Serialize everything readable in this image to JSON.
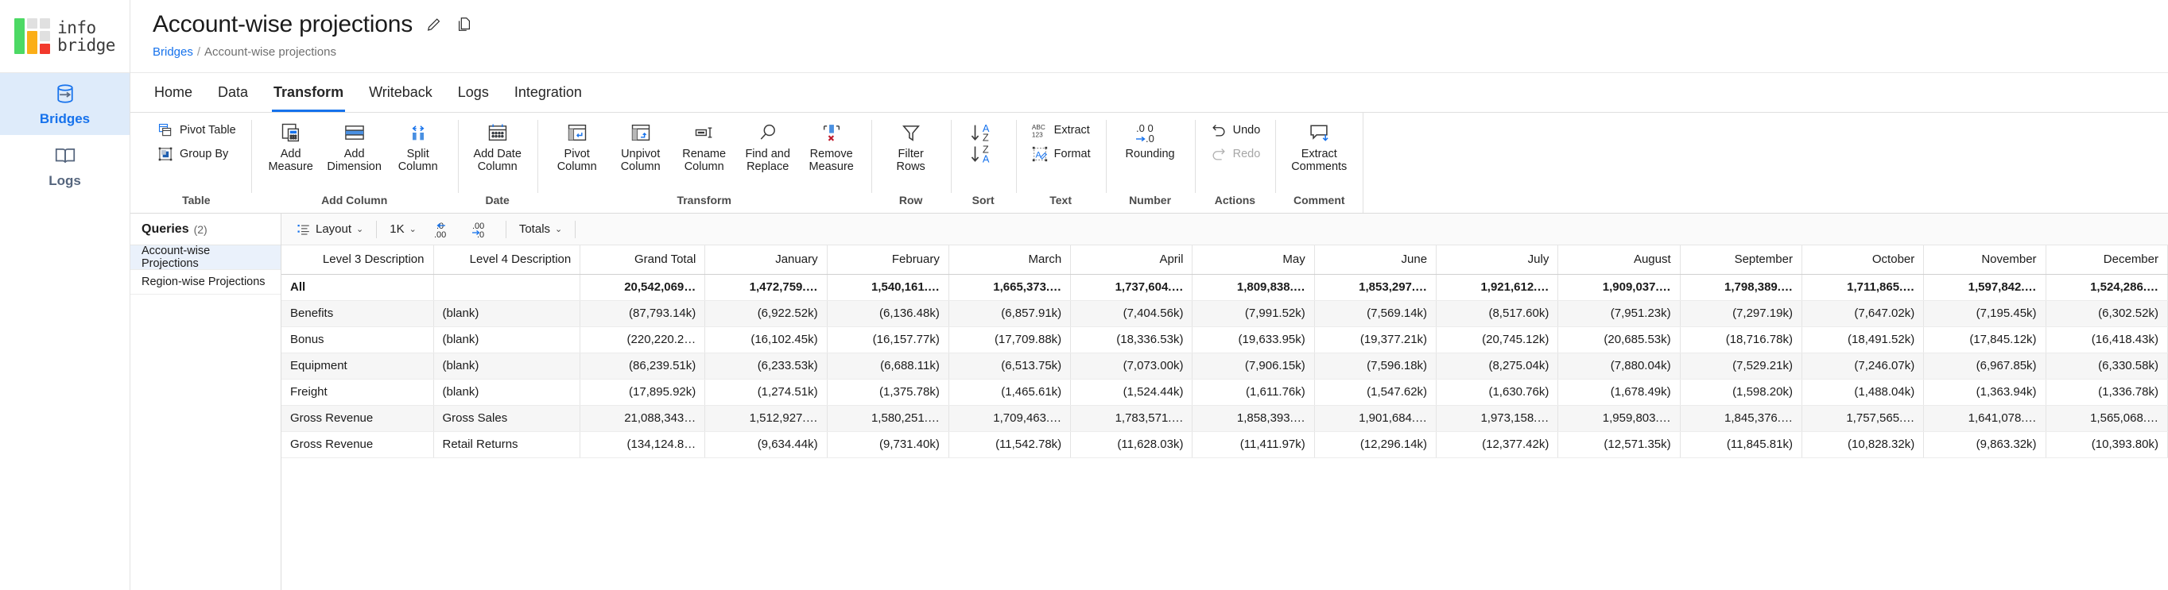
{
  "brand": {
    "word1": "info",
    "word2": "bridge",
    "colors": {
      "red": "#f2392c",
      "orange": "#fbae17",
      "green": "#4cd964",
      "grey": "#e0e0e0",
      "accent": "#1672ec"
    }
  },
  "rail": {
    "items": [
      {
        "label": "Bridges",
        "icon": "database-bridge-icon",
        "active": true
      },
      {
        "label": "Logs",
        "icon": "book-icon",
        "active": false
      }
    ]
  },
  "header": {
    "title": "Account-wise projections",
    "edit_icon": "pencil-icon",
    "copy_icon": "copy-icon",
    "breadcrumb": {
      "root": "Bridges",
      "separator": "/",
      "current": "Account-wise projections"
    }
  },
  "tabs": [
    {
      "label": "Home",
      "active": false
    },
    {
      "label": "Data",
      "active": false
    },
    {
      "label": "Transform",
      "active": true
    },
    {
      "label": "Writeback",
      "active": false
    },
    {
      "label": "Logs",
      "active": false
    },
    {
      "label": "Integration",
      "active": false
    }
  ],
  "ribbon": {
    "groups": [
      {
        "label": "Table",
        "layout": "stack",
        "items": [
          {
            "label": "Pivot Table",
            "icon": "pivot-table-icon"
          },
          {
            "label": "Group By",
            "icon": "group-by-icon"
          }
        ]
      },
      {
        "label": "Add Column",
        "layout": "big",
        "items": [
          {
            "label": "Add Measure",
            "icon": "add-measure-icon"
          },
          {
            "label": "Add Dimension",
            "icon": "add-dimension-icon"
          },
          {
            "label": "Split Column",
            "icon": "split-column-icon"
          }
        ]
      },
      {
        "label": "Date",
        "layout": "big",
        "items": [
          {
            "label": "Add Date Column",
            "icon": "calendar-icon"
          }
        ]
      },
      {
        "label": "Transform",
        "layout": "big",
        "items": [
          {
            "label": "Pivot Column",
            "icon": "pivot-column-icon"
          },
          {
            "label": "Unpivot Column",
            "icon": "unpivot-column-icon"
          },
          {
            "label": "Rename Column",
            "icon": "rename-column-icon"
          },
          {
            "label": "Find and Replace",
            "icon": "search-icon"
          },
          {
            "label": "Remove Measure",
            "icon": "remove-measure-icon"
          }
        ]
      },
      {
        "label": "Row",
        "layout": "big",
        "items": [
          {
            "label": "Filter Rows",
            "icon": "funnel-icon"
          }
        ]
      },
      {
        "label": "Sort",
        "layout": "big",
        "items": [
          {
            "label": "",
            "icon": "sort-az-za-icon"
          }
        ]
      },
      {
        "label": "Text",
        "layout": "stack",
        "items": [
          {
            "label": "Extract",
            "icon": "abc-123-icon"
          },
          {
            "label": "Format",
            "icon": "format-text-icon"
          }
        ]
      },
      {
        "label": "Number",
        "layout": "big",
        "items": [
          {
            "label": "Rounding",
            "icon": "rounding-icon"
          }
        ]
      },
      {
        "label": "Actions",
        "layout": "stack",
        "items": [
          {
            "label": "Undo",
            "icon": "undo-icon",
            "disabled": false
          },
          {
            "label": "Redo",
            "icon": "redo-icon",
            "disabled": true
          }
        ]
      },
      {
        "label": "Comment",
        "layout": "big",
        "items": [
          {
            "label": "Extract Comments",
            "icon": "comment-extract-icon"
          }
        ]
      }
    ]
  },
  "queries": {
    "title": "Queries",
    "count": "(2)",
    "items": [
      {
        "label": "Account-wise Projections",
        "active": true
      },
      {
        "label": "Region-wise Projections",
        "active": false
      }
    ]
  },
  "subbar": {
    "layout_label": "Layout",
    "layout_icon": "layout-list-icon",
    "scale_label": "1K",
    "decrease_decimal_icon": "decrease-decimal-icon",
    "increase_decimal_icon": "increase-decimal-icon",
    "totals_label": "Totals",
    "caret": "⌄"
  },
  "chart_data": {
    "type": "table",
    "title": "Account-wise projections",
    "columns": [
      "Level 3 Description",
      "Level 4 Description",
      "Grand Total",
      "January",
      "February",
      "March",
      "April",
      "May",
      "June",
      "July",
      "August",
      "September",
      "October",
      "November",
      "December"
    ],
    "rows": [
      {
        "total": true,
        "cells": [
          "All",
          "",
          "20,542,069…",
          "1,472,759.…",
          "1,540,161.…",
          "1,665,373.…",
          "1,737,604.…",
          "1,809,838.…",
          "1,853,297.…",
          "1,921,612.…",
          "1,909,037.…",
          "1,798,389.…",
          "1,711,865.…",
          "1,597,842.…",
          "1,524,286.…"
        ]
      },
      {
        "total": false,
        "cells": [
          "Benefits",
          "(blank)",
          "(87,793.14k)",
          "(6,922.52k)",
          "(6,136.48k)",
          "(6,857.91k)",
          "(7,404.56k)",
          "(7,991.52k)",
          "(7,569.14k)",
          "(8,517.60k)",
          "(7,951.23k)",
          "(7,297.19k)",
          "(7,647.02k)",
          "(7,195.45k)",
          "(6,302.52k)"
        ]
      },
      {
        "total": false,
        "cells": [
          "Bonus",
          "(blank)",
          "(220,220.2…",
          "(16,102.45k)",
          "(16,157.77k)",
          "(17,709.88k)",
          "(18,336.53k)",
          "(19,633.95k)",
          "(19,377.21k)",
          "(20,745.12k)",
          "(20,685.53k)",
          "(18,716.78k)",
          "(18,491.52k)",
          "(17,845.12k)",
          "(16,418.43k)"
        ]
      },
      {
        "total": false,
        "cells": [
          "Equipment",
          "(blank)",
          "(86,239.51k)",
          "(6,233.53k)",
          "(6,688.11k)",
          "(6,513.75k)",
          "(7,073.00k)",
          "(7,906.15k)",
          "(7,596.18k)",
          "(8,275.04k)",
          "(7,880.04k)",
          "(7,529.21k)",
          "(7,246.07k)",
          "(6,967.85k)",
          "(6,330.58k)"
        ]
      },
      {
        "total": false,
        "cells": [
          "Freight",
          "(blank)",
          "(17,895.92k)",
          "(1,274.51k)",
          "(1,375.78k)",
          "(1,465.61k)",
          "(1,524.44k)",
          "(1,611.76k)",
          "(1,547.62k)",
          "(1,630.76k)",
          "(1,678.49k)",
          "(1,598.20k)",
          "(1,488.04k)",
          "(1,363.94k)",
          "(1,336.78k)"
        ]
      },
      {
        "total": false,
        "cells": [
          "Gross Revenue",
          "Gross Sales",
          "21,088,343…",
          "1,512,927.…",
          "1,580,251.…",
          "1,709,463.…",
          "1,783,571.…",
          "1,858,393.…",
          "1,901,684.…",
          "1,973,158.…",
          "1,959,803.…",
          "1,845,376.…",
          "1,757,565.…",
          "1,641,078.…",
          "1,565,068.…"
        ]
      },
      {
        "total": false,
        "cells": [
          "Gross Revenue",
          "Retail Returns",
          "(134,124.8…",
          "(9,634.44k)",
          "(9,731.40k)",
          "(11,542.78k)",
          "(11,628.03k)",
          "(11,411.97k)",
          "(12,296.14k)",
          "(12,377.42k)",
          "(12,571.35k)",
          "(11,845.81k)",
          "(10,828.32k)",
          "(9,863.32k)",
          "(10,393.80k)"
        ]
      }
    ]
  }
}
